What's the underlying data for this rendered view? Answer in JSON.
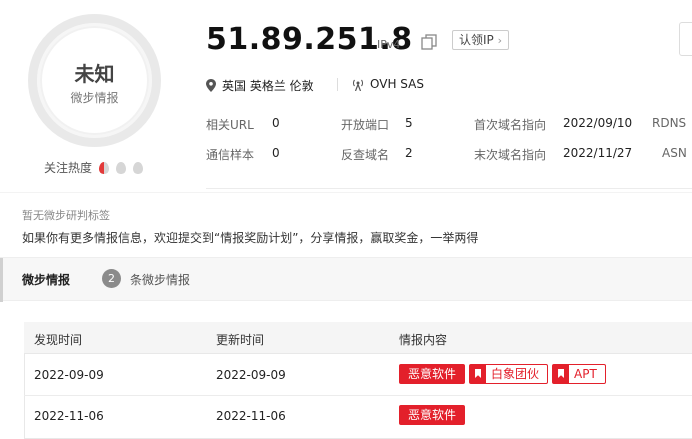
{
  "badge": {
    "verdict": "未知",
    "verdict_sub": "微步情报",
    "heat_label": "关注热度"
  },
  "ip": {
    "address": "51.89.251.8",
    "version": "IPv4",
    "claim_button": "认领IP"
  },
  "location": {
    "text": "英国 英格兰 伦敦",
    "isp": "OVH SAS"
  },
  "stats": [
    {
      "label": "相关URL",
      "value": "0"
    },
    {
      "label": "开放端口",
      "value": "5"
    },
    {
      "label": "首次域名指向",
      "value": "2022/09/10"
    },
    {
      "label": "RDNS",
      "value": ""
    },
    {
      "label": "通信样本",
      "value": "0"
    },
    {
      "label": "反查域名",
      "value": "2"
    },
    {
      "label": "末次域名指向",
      "value": "2022/11/27"
    },
    {
      "label": "ASN",
      "value": ""
    }
  ],
  "tags_note": "暂无微步研判标签",
  "promo_text": "如果你有更多情报信息，欢迎提交到“情报奖励计划”，分享情报，赢取奖金，一举两得",
  "tabs": {
    "active": "微步情报",
    "count": "2",
    "count_label": "条微步情报"
  },
  "table": {
    "headers": [
      "发现时间",
      "更新时间",
      "情报内容"
    ],
    "rows": [
      {
        "found": "2022-09-09",
        "updated": "2022-09-09",
        "tags": [
          "恶意软件",
          "白象团伙",
          "APT"
        ]
      },
      {
        "found": "2022-11-06",
        "updated": "2022-11-06",
        "tags": [
          "恶意软件"
        ]
      }
    ]
  },
  "colors": {
    "danger": "#e3202b"
  }
}
